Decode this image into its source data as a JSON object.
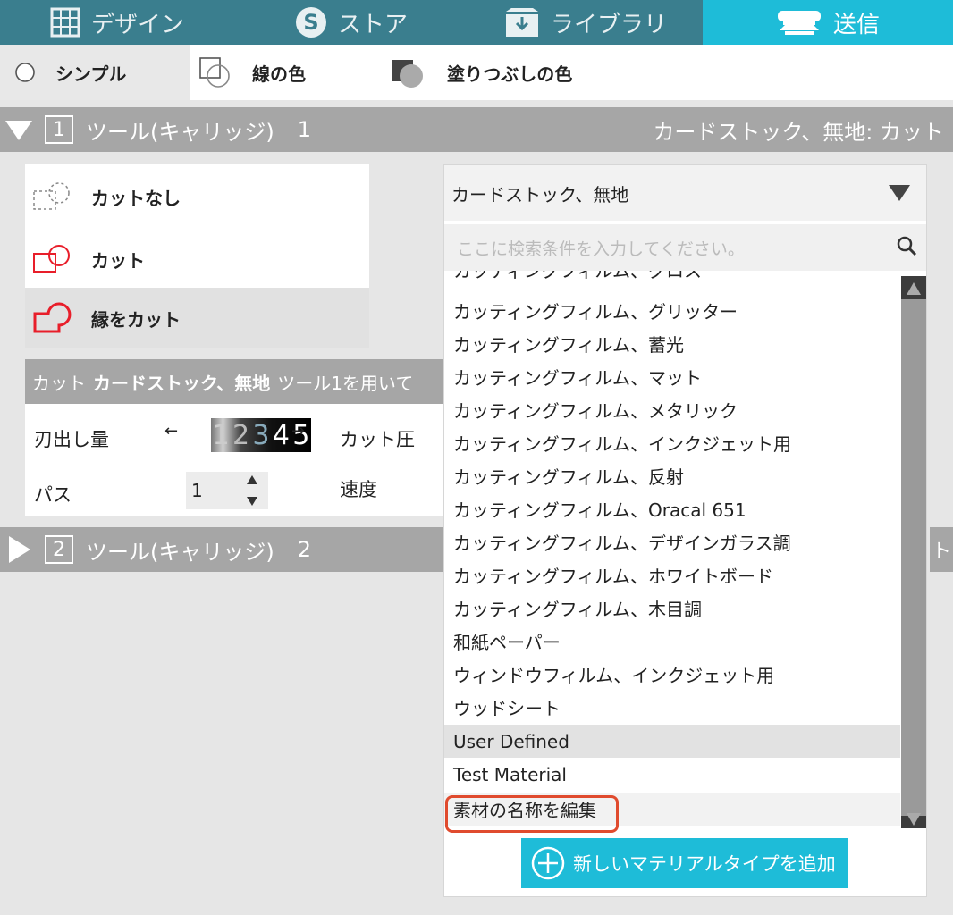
{
  "tabs": [
    {
      "label": "デザイン",
      "icon": "grid-icon"
    },
    {
      "label": "ストア",
      "icon": "silhouette-s-icon"
    },
    {
      "label": "ライブラリ",
      "icon": "library-box-icon"
    },
    {
      "label": "送信",
      "icon": "cutter-machine-icon",
      "active": true
    }
  ],
  "modes": {
    "simple": "シンプル",
    "stroke": "線の色",
    "fill": "塗りつぶしの色"
  },
  "carriage1": {
    "number": "1",
    "title": "ツール(キャリッジ)",
    "index": "1",
    "summary": "カードストック、無地: カット"
  },
  "carriage2": {
    "number": "2",
    "title": "ツール(キャリッジ)",
    "index": "2"
  },
  "cut_options": [
    {
      "label": "カットなし",
      "icon": "no-cut-icon"
    },
    {
      "label": "カット",
      "icon": "cut-icon"
    },
    {
      "label": "縁をカット",
      "icon": "cut-edge-icon",
      "selected": true
    }
  ],
  "settings": {
    "header_prefix": "カット",
    "header_material": "カードストック、無地",
    "header_suffix": "ツール1を用いて",
    "blade_label": "刃出し量",
    "blade_digits": [
      "1",
      "2",
      "3",
      "4",
      "5"
    ],
    "force_label": "カット圧",
    "passes_label": "パス",
    "passes_value": "1",
    "speed_label": "速度"
  },
  "dropdown": {
    "selected": "カードストック、無地",
    "search_placeholder": "ここに検索条件を入力してください。",
    "items": [
      "カッティングフィルム、グロス",
      "カッティングフィルム、グリッター",
      "カッティングフィルム、蓄光",
      "カッティングフィルム、マット",
      "カッティングフィルム、メタリック",
      "カッティングフィルム、インクジェット用",
      "カッティングフィルム、反射",
      "カッティングフィルム、Oracal 651",
      "カッティングフィルム、デザインガラス調",
      "カッティングフィルム、ホワイトボード",
      "カッティングフィルム、木目調",
      "和紙ペーパー",
      "ウィンドウフィルム、インクジェット用",
      "ウッドシート",
      "User Defined",
      "Test Material",
      "素材の名称を編集"
    ],
    "add_button": "新しいマテリアルタイプを追加"
  },
  "side_fragment": "ト",
  "colors": {
    "tab_bar": "#3a7e8e",
    "active_tab": "#1ebcd8",
    "header_grey": "#a6a6a6",
    "highlight_outline": "#e04b2e",
    "cut_icon": "#e81e2a"
  }
}
